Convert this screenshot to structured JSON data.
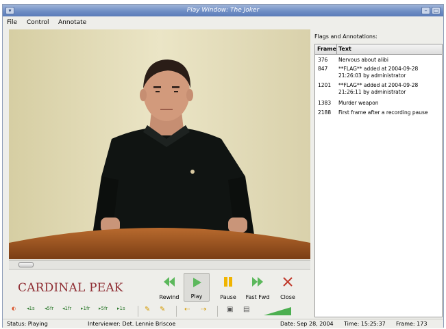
{
  "window": {
    "title": "Play Window: The Joker"
  },
  "menubar": {
    "file": "File",
    "control": "Control",
    "annotate": "Annotate"
  },
  "logo": {
    "text": "CARDINAL PEAK"
  },
  "controls": {
    "rewind": "Rewind",
    "play": "Play",
    "pause": "Pause",
    "fast_fwd": "Fast Fwd",
    "close": "Close"
  },
  "toolbar": {
    "steps": [
      "1s",
      "5fr",
      "1fr",
      "1fr",
      "5fr",
      "1s"
    ]
  },
  "panel": {
    "title": "Flags and Annotations:",
    "columns": [
      "Frame",
      "Text"
    ],
    "rows": [
      {
        "frame": "376",
        "text": "Nervous about alibi"
      },
      {
        "frame": "847",
        "text": "**FLAG** added at 2004-09-28 21:26:03 by administrator"
      },
      {
        "frame": "1201",
        "text": "**FLAG** added at 2004-09-28 21:26:11 by administrator"
      },
      {
        "frame": "1383",
        "text": "Murder weapon"
      },
      {
        "frame": "2188",
        "text": "First frame after a recording pause"
      }
    ]
  },
  "status": {
    "state": "Status: Playing",
    "interviewer": "Interviewer: Det. Lennie Briscoe",
    "date": "Date: Sep 28, 2004",
    "time": "Time: 15:25:37",
    "frame": "Frame: 173"
  },
  "colors": {
    "logo": "#8f2d33",
    "accent_green": "#4caf50",
    "pause": "#f0b400",
    "close": "#c0392b"
  }
}
